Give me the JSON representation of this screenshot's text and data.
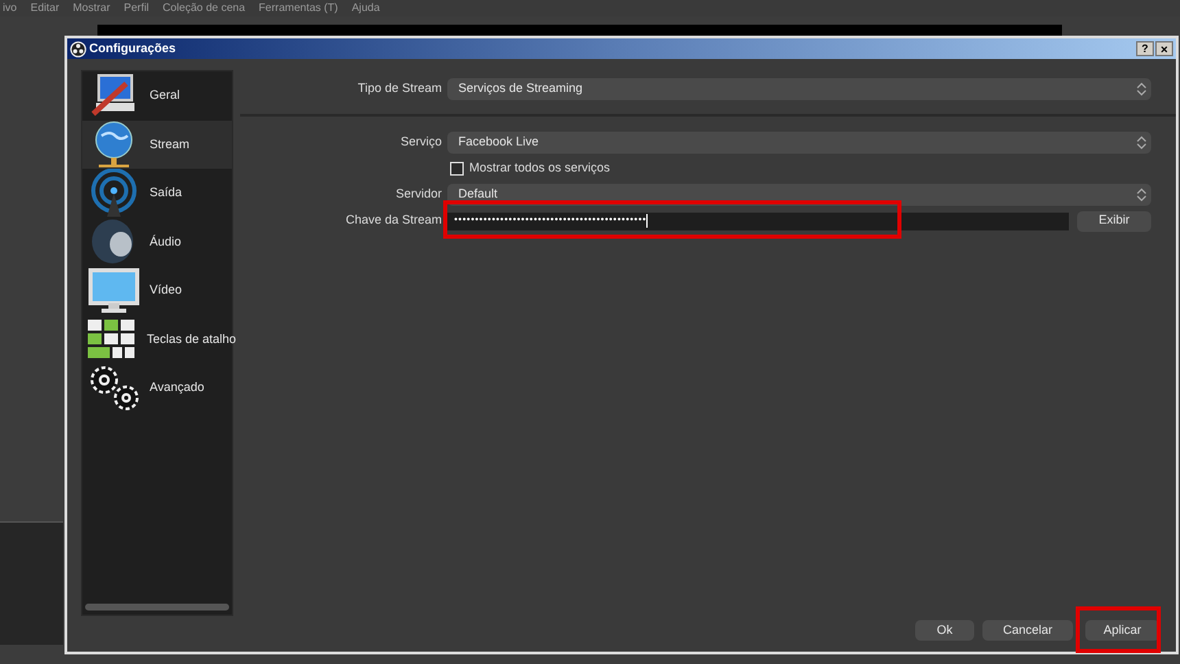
{
  "app_menu": [
    "ivo",
    "Editar",
    "Mostrar",
    "Perfil",
    "Coleção de cena",
    "Ferramentas (T)",
    "Ajuda"
  ],
  "window": {
    "title": "Configurações",
    "help": "?",
    "close": "×"
  },
  "sidebar": {
    "items": [
      {
        "label": "Geral",
        "kind": "general",
        "selected": false
      },
      {
        "label": "Stream",
        "kind": "stream",
        "selected": true
      },
      {
        "label": "Saída",
        "kind": "output",
        "selected": false
      },
      {
        "label": "Áudio",
        "kind": "audio",
        "selected": false
      },
      {
        "label": "Vídeo",
        "kind": "video",
        "selected": false
      },
      {
        "label": "Teclas de atalho",
        "kind": "hotkeys",
        "selected": false
      },
      {
        "label": "Avançado",
        "kind": "advanced",
        "selected": false
      }
    ]
  },
  "stream_type": {
    "label": "Tipo de Stream",
    "value": "Serviços de Streaming"
  },
  "service": {
    "label": "Serviço",
    "value": "Facebook Live"
  },
  "show_all": {
    "label": "Mostrar todos os serviços",
    "checked": false
  },
  "server": {
    "label": "Servidor",
    "value": "Default"
  },
  "stream_key": {
    "label": "Chave da Stream",
    "value": "••••••••••••••••••••••••••••••••••••••••••••••",
    "button": "Exibir",
    "highlighted": true
  },
  "buttons": [
    {
      "label": "Ok",
      "highlighted": false
    },
    {
      "label": "Cancelar",
      "highlighted": false
    },
    {
      "label": "Aplicar",
      "highlighted": true
    }
  ]
}
